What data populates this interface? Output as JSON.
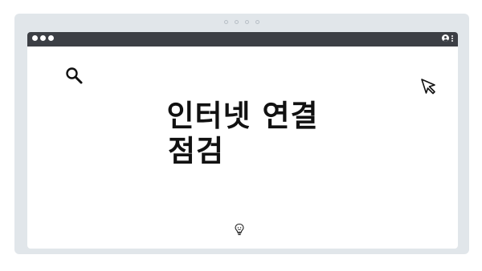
{
  "header": {
    "pager_dots": [
      "dot-1",
      "dot-2",
      "dot-3",
      "dot-4"
    ]
  },
  "window": {
    "title_bar_color": "#3c3f45",
    "traffic_dots": [
      "dot",
      "dot",
      "dot"
    ],
    "right_icons": [
      "profile-icon",
      "kebab-menu-icon"
    ]
  },
  "main": {
    "headline_line_1": "인터넷 연결",
    "headline_line_2": "점검",
    "icons": [
      "search-icon",
      "cursor-icon",
      "lightbulb-icon"
    ]
  },
  "colors": {
    "panel_background": "#e1e6ea",
    "title_bar": "#3c3f45",
    "text": "#111111",
    "window_background": "#ffffff"
  }
}
